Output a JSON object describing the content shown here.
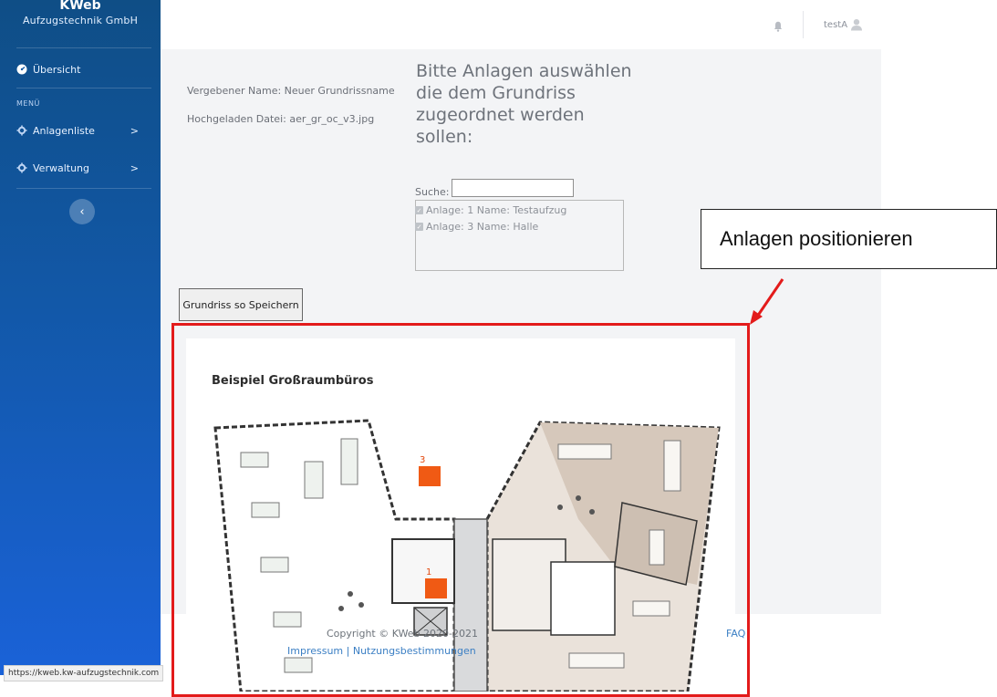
{
  "sidebar": {
    "brand_title": "KWeb",
    "brand_subtitle": "Aufzugstechnik GmbH",
    "section_label": "MENÜ",
    "items": [
      {
        "label": "Übersicht",
        "icon": "dashboard-icon"
      },
      {
        "label": "Anlagenliste",
        "icon": "gear-icon",
        "chevron": ">"
      },
      {
        "label": "Verwaltung",
        "icon": "gear-icon",
        "chevron": ">"
      }
    ],
    "collapse_symbol": "‹",
    "colors": {
      "top": "#0f4e86",
      "bottom": "#1a62d8"
    }
  },
  "header": {
    "username": "testA",
    "bell_icon": "bell-icon",
    "user_icon": "user-icon"
  },
  "main": {
    "assigned_name": "Vergebener Name: Neuer Grundrissname",
    "uploaded_file": "Hochgeladen Datei: aer_gr_oc_v3.jpg",
    "heading": "Bitte Anlagen auswählen die dem Grundriss zugeordnet werden sollen:",
    "search_label": "Suche:",
    "search_value": "",
    "anlagen": [
      {
        "label": "Anlage: 1 Name: Testaufzug",
        "checked": true
      },
      {
        "label": "Anlage: 3 Name: Halle",
        "checked": true
      }
    ],
    "save_button": "Grundriss so Speichern"
  },
  "floorplan": {
    "title": "Beispiel Großraumbüros",
    "markers": [
      {
        "label": "3",
        "color": "#f05a14"
      },
      {
        "label": "1",
        "color": "#f05a14"
      }
    ]
  },
  "annotation": {
    "callout_text": "Anlagen positionieren",
    "frame_color": "#e31b1b"
  },
  "footer": {
    "copyright": "Copyright © KWeb 2020-2021",
    "impressum": "Impressum",
    "separator": "|",
    "nutzung": "Nutzungsbestimmungen",
    "faq": "FAQ"
  },
  "status_bar": {
    "url": "https://kweb.kw-aufzugstechnik.com"
  }
}
